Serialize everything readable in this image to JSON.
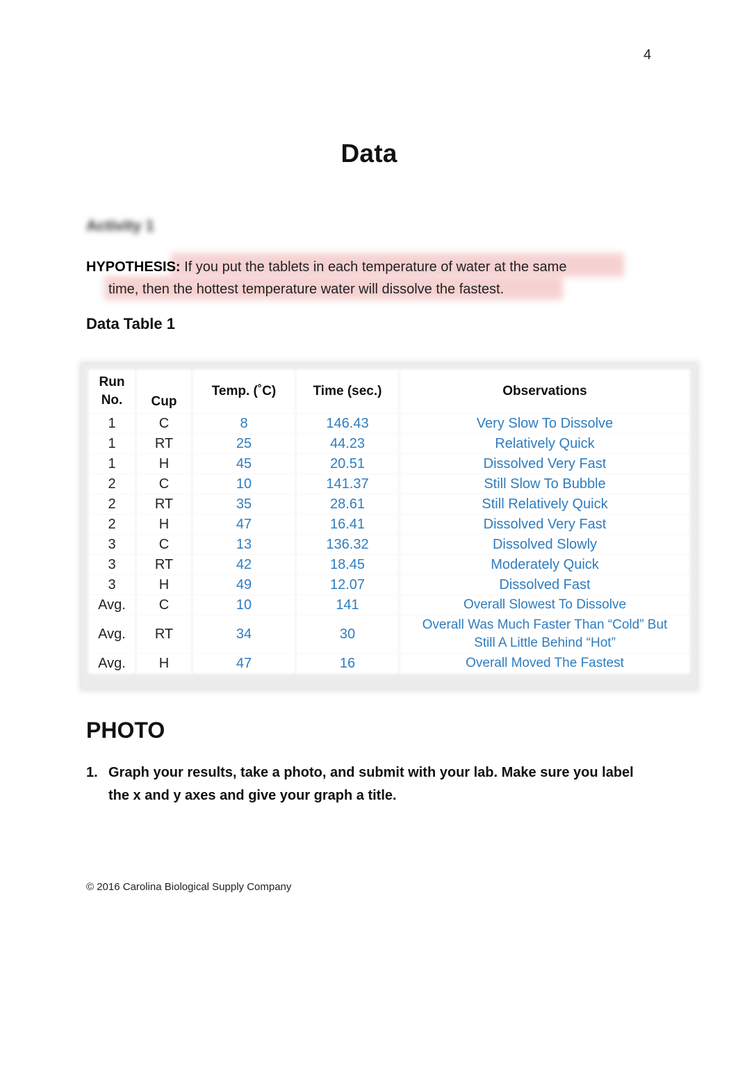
{
  "page_number": "4",
  "title": "Data",
  "activity_label": "Activity 1",
  "hypothesis": {
    "label": "HYPOTHESIS:",
    "line1": "If you put the tablets in each temperature of water at the same",
    "line2": "time, then the hottest temperature water will dissolve the fastest.",
    "highlight_color": "#f4c9c9"
  },
  "table_title": "Data Table 1",
  "table": {
    "headers": {
      "run_line1": "Run",
      "run_line2": "No.",
      "cup": "Cup",
      "temp": "Temp. (˚C)",
      "time": "Time (sec.)",
      "observations": "Observations"
    },
    "value_color": "#2e7dc0",
    "rows": [
      {
        "run": "1",
        "cup": "C",
        "temp": "8",
        "time": "146.43",
        "obs": "Very Slow To Dissolve"
      },
      {
        "run": "1",
        "cup": "RT",
        "temp": "25",
        "time": "44.23",
        "obs": "Relatively Quick"
      },
      {
        "run": "1",
        "cup": "H",
        "temp": "45",
        "time": "20.51",
        "obs": "Dissolved Very Fast"
      },
      {
        "run": "2",
        "cup": "C",
        "temp": "10",
        "time": "141.37",
        "obs": "Still Slow To Bubble"
      },
      {
        "run": "2",
        "cup": "RT",
        "temp": "35",
        "time": "28.61",
        "obs": "Still Relatively Quick"
      },
      {
        "run": "2",
        "cup": "H",
        "temp": "47",
        "time": "16.41",
        "obs": "Dissolved Very Fast"
      },
      {
        "run": "3",
        "cup": "C",
        "temp": "13",
        "time": "136.32",
        "obs": "Dissolved Slowly"
      },
      {
        "run": "3",
        "cup": "RT",
        "temp": "42",
        "time": "18.45",
        "obs": "Moderately Quick"
      },
      {
        "run": "3",
        "cup": "H",
        "temp": "49",
        "time": "12.07",
        "obs": "Dissolved Fast"
      },
      {
        "run": "Avg.",
        "cup": "C",
        "temp": "10",
        "time": "141",
        "obs": "Overall Slowest To Dissolve"
      },
      {
        "run": "Avg.",
        "cup": "RT",
        "temp": "34",
        "time": "30",
        "obs": "Overall Was Much Faster Than “Cold” But",
        "obs2": "Still A Little Behind “Hot”"
      },
      {
        "run": "Avg.",
        "cup": "H",
        "temp": "47",
        "time": "16",
        "obs": "Overall Moved The Fastest"
      }
    ]
  },
  "section_title": "PHOTO",
  "instruction": {
    "number": "1.",
    "text": "Graph your results, take a photo, and submit with your lab. Make sure you label the x and y axes and give your graph a title."
  },
  "footer": "© 2016 Carolina Biological Supply Company"
}
